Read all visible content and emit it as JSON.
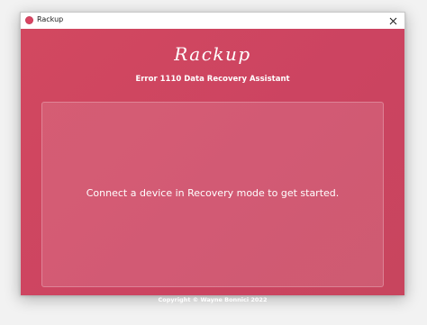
{
  "window": {
    "title": "Rackup",
    "icon": "rackup-logo-icon",
    "accent_color": "#d24860"
  },
  "header": {
    "app_name": "Rackup",
    "subtitle": "Error 1110 Data Recovery Assistant"
  },
  "panel": {
    "message": "Connect a device in Recovery mode to get started."
  },
  "footer": {
    "copyright": "Copyright © Wayne Bonnici 2022"
  }
}
